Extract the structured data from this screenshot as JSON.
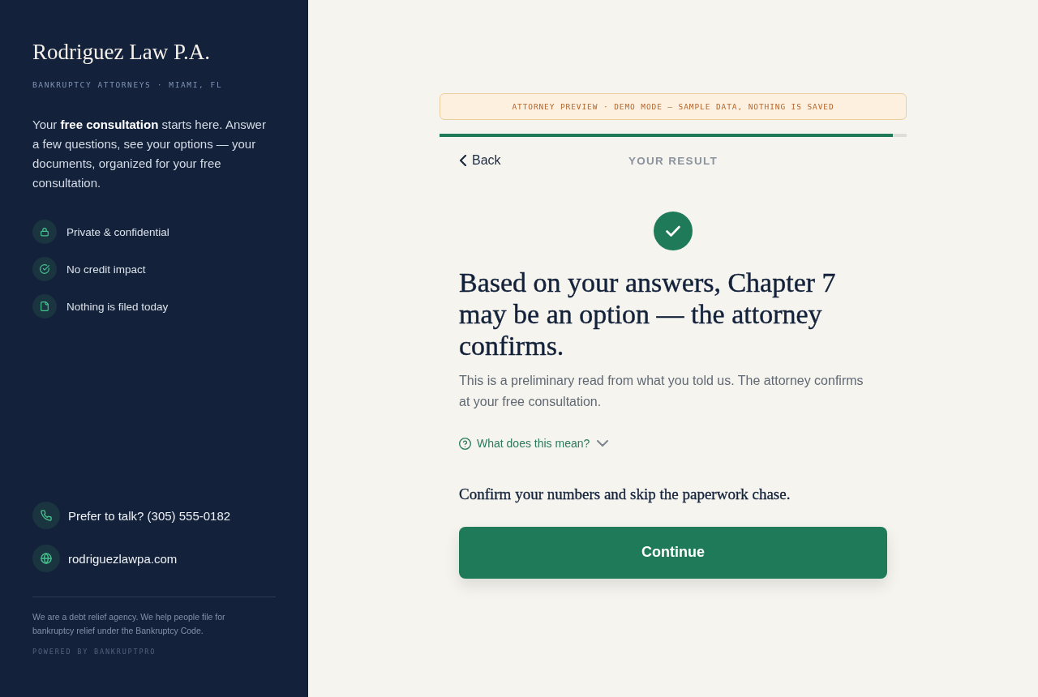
{
  "sidebar": {
    "firm_name": "Rodriguez Law P.A.",
    "tagline": "BANKRUPTCY ATTORNEYS · MIAMI, FL",
    "intro": "Your **free consultation** starts here. Answer a few questions, see your options — your documents, organized for your free consultation.",
    "features": [
      {
        "kind": "lock",
        "label": "Private & confidential"
      },
      {
        "kind": "check",
        "label": "No credit impact"
      },
      {
        "kind": "document",
        "label": "Nothing is filed today"
      }
    ],
    "contacts": [
      {
        "kind": "phone",
        "label": "Prefer to talk? (305) 555-0182"
      },
      {
        "kind": "globe",
        "label": "rodriguezlawpa.com"
      }
    ],
    "disclaimer": "We are a debt relief agency. We help people file for bankruptcy relief under the Bankruptcy Code.",
    "powered_by": "POWERED BY BANKRUPTPRO"
  },
  "banner": "ATTORNEY PREVIEW · DEMO MODE — SAMPLE DATA, NOTHING IS SAVED",
  "progress": {
    "level": 0.97
  },
  "nav": {
    "back": "Back",
    "step_title": "YOUR RESULT"
  },
  "result": {
    "heading": "Based on your answers, Chapter 7 may be an option — the attorney confirms.",
    "description": "This is a preliminary read from what you told us. The attorney confirms at your free consultation.",
    "help_toggle": {
      "label": "What does this mean?",
      "expanded": false
    },
    "prompt": "Confirm your numbers and skip the paperwork chase.",
    "button": "Continue"
  }
}
